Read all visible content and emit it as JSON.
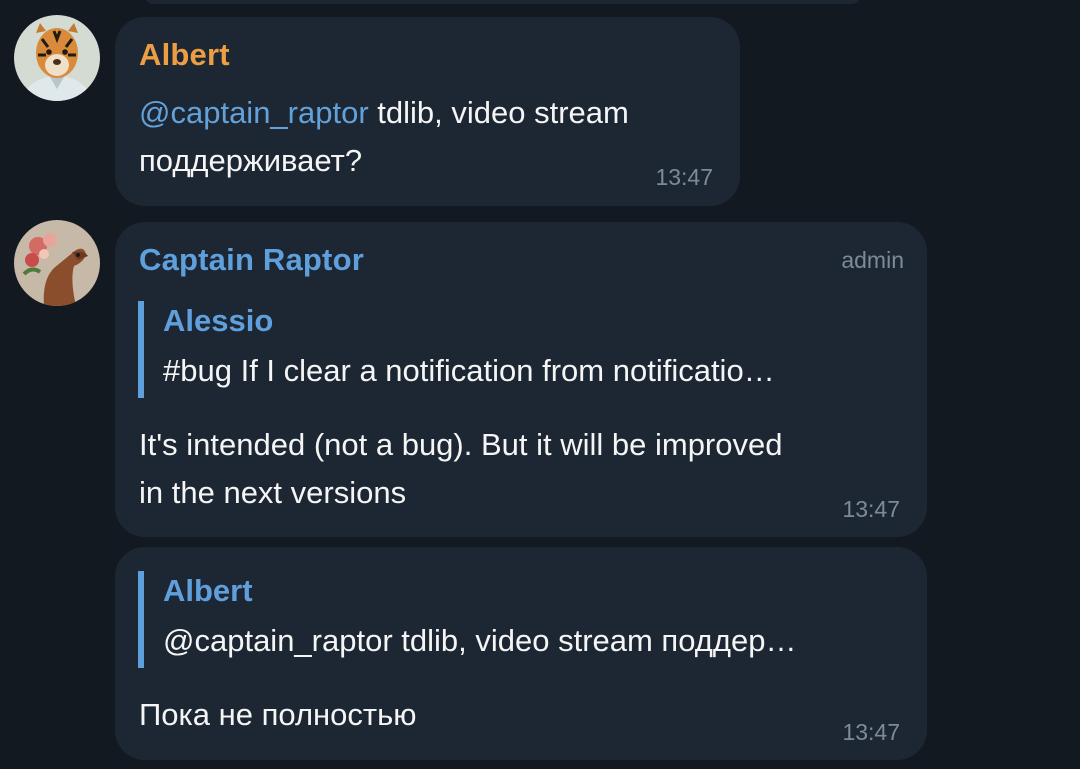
{
  "messages": [
    {
      "sender": "Albert",
      "sender_color": "#ec9e45",
      "mention": "@captain_raptor",
      "text_line1_rest": " tdlib, video stream",
      "text_line2": "поддерживает?",
      "time": "13:47",
      "avatar_icon": "tiger-avatar"
    },
    {
      "sender": "Captain Raptor",
      "sender_color": "#5fa0dc",
      "badge": "admin",
      "reply": {
        "name": "Alessio",
        "text": "#bug If I clear a notification from notificatio…"
      },
      "text_line1": "It's intended (not a bug). But it will be improved",
      "text_line2": "in the next versions",
      "time": "13:47",
      "avatar_icon": "raptor-avatar"
    },
    {
      "reply": {
        "name": "Albert",
        "text": "@captain_raptor tdlib, video stream поддер…"
      },
      "text_line1": "Пока не полностью",
      "time": "13:47"
    }
  ]
}
